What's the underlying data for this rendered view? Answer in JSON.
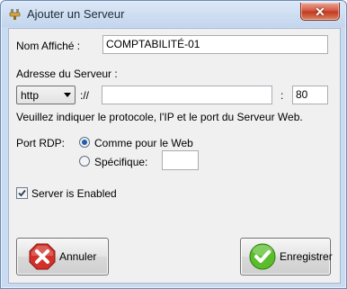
{
  "window": {
    "title": "Ajouter un Serveur",
    "close_glyph": "✕"
  },
  "form": {
    "display_name_label": "Nom Affiché :",
    "display_name_value": "COMPTABILITÉ-01",
    "server_address_label": "Adresse du Serveur :",
    "protocol_selected": "http",
    "protocol_separator": "://",
    "host_value": "",
    "port_separator": ":",
    "port_value": "80",
    "hint": "Veuillez indiquer le protocole, l'IP et le port du Serveur Web.",
    "rdp_port_label": "Port RDP:",
    "rdp_option_same": "Comme pour le Web",
    "rdp_option_specific": "Spécifique:",
    "rdp_specific_value": "",
    "rdp_selected": "same",
    "server_enabled_label": "Server is Enabled",
    "server_enabled_checked": true
  },
  "buttons": {
    "cancel_label": "Annuler",
    "save_label": "Enregistrer"
  },
  "icons": {
    "title": "app-plug-icon",
    "cancel": "cancel-x-icon",
    "save": "save-check-icon"
  },
  "colors": {
    "cancel_red": "#d2312a",
    "save_green": "#5bbd2b",
    "accent_blue": "#1f5dad"
  }
}
